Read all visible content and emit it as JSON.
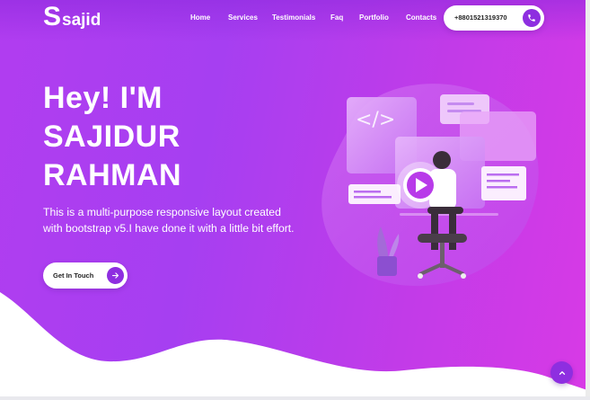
{
  "brand": {
    "logo_initial": "S",
    "logo_rest": "sajid"
  },
  "nav": {
    "items": [
      "Home",
      "Services",
      "Testimonials",
      "Faq",
      "Portfolio",
      "Contacts"
    ]
  },
  "contact": {
    "phone": "+8801521319370",
    "phone_icon": "phone-icon"
  },
  "hero": {
    "headline": [
      "Hey! I'M",
      "SAJIDUR",
      "RAHMAN"
    ],
    "description": "This is a multi-purpose responsive layout created with bootstrap v5.I have done it with a little bit effort.",
    "cta_label": "Get In Touch",
    "cta_icon": "arrow-right-icon",
    "illustration_code_tag": "</>"
  },
  "scroll_top_icon": "chevron-up-icon",
  "colors": {
    "accent": "#8e2ee0",
    "gradient_start": "#b13df0",
    "gradient_end": "#d83ae6",
    "white": "#ffffff"
  }
}
